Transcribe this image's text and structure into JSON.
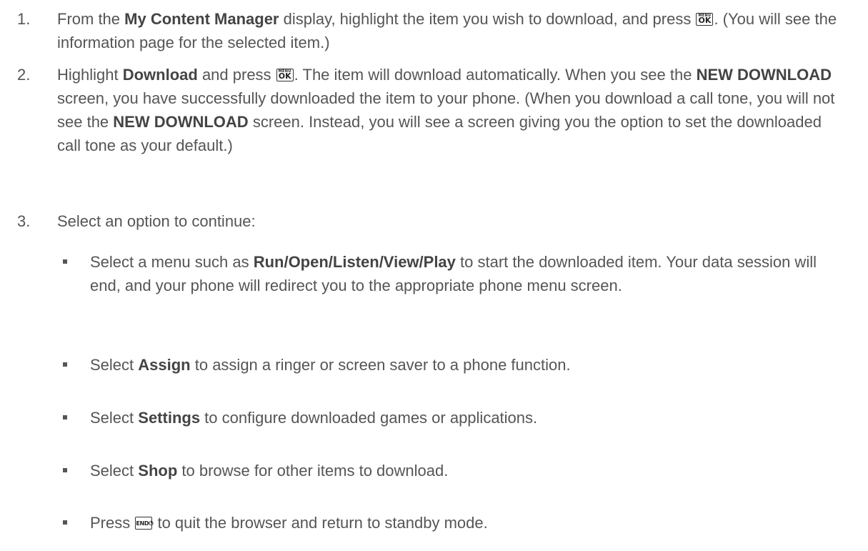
{
  "steps": [
    {
      "num": "1.",
      "t1": "From the ",
      "b1": "My Content Manager",
      "t2": " display, highlight the item you wish to download, and press ",
      "key": {
        "top": "MENU",
        "bottom": "OK"
      },
      "t3": ". (You will see the information page for the selected item.)"
    },
    {
      "num": "2.",
      "t1": "Highlight ",
      "b1": "Download",
      "t2": " and press ",
      "key": {
        "top": "MENU",
        "bottom": "OK"
      },
      "t3": ". The item will download automatically. When you see the ",
      "b2": "NEW DOWNLOAD",
      "t4": " screen, you have successfully downloaded the item to your phone. (When you download a call tone, you will not see the ",
      "b3": "NEW DOWNLOAD",
      "t5": " screen. Instead, you will see a screen giving you the option to set the downloaded call tone as your default.)"
    },
    {
      "num": "3.",
      "t1": "Select an option to continue:"
    }
  ],
  "bullets": [
    {
      "t1": "Select a menu such as ",
      "b1": "Run/Open/Listen/View/Play",
      "t2": " to start the downloaded item. Your data session will end, and your phone will redirect you to the appropriate phone menu screen."
    },
    {
      "t1": "Select ",
      "b1": "Assign",
      "t2": " to assign a ringer or screen saver to a phone function."
    },
    {
      "t1": "Select ",
      "b1": "Settings",
      "t2": " to configure downloaded games or applications."
    },
    {
      "t1": "Select ",
      "b1": "Shop",
      "t2": " to browse for other items to download."
    },
    {
      "t1": "Press ",
      "key": {
        "top": "",
        "bottom": "END⏻"
      },
      "t2": " to quit the browser and return to standby mode."
    }
  ]
}
